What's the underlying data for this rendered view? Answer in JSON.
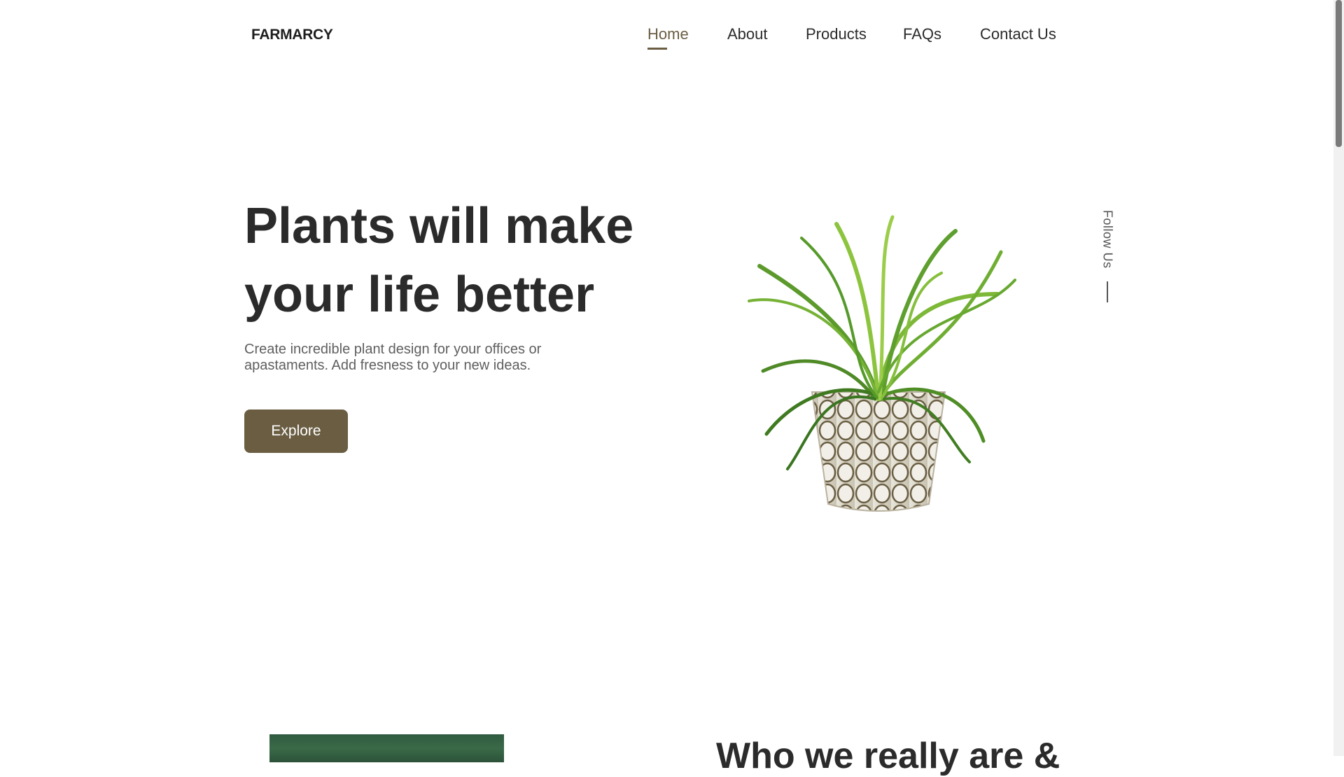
{
  "brand": {
    "logo": "FARMARCY"
  },
  "nav": {
    "items": [
      {
        "label": "Home",
        "active": true
      },
      {
        "label": "About",
        "active": false
      },
      {
        "label": "Products",
        "active": false
      },
      {
        "label": "FAQs",
        "active": false
      },
      {
        "label": "Contact Us",
        "active": false
      }
    ]
  },
  "hero": {
    "title_line1": "Plants will make",
    "title_line2": "your life better",
    "description": "Create incredible plant design for your offices or apastaments. Add fresness to your new ideas.",
    "cta_label": "Explore",
    "image_icon": "potted-plant-image"
  },
  "social": {
    "label": "Follow Us"
  },
  "about": {
    "title": "Who we really are &"
  },
  "colors": {
    "accent": "#6a5d42",
    "text": "#2b2b2b",
    "muted": "#5f5f5f",
    "background": "#ffffff"
  }
}
